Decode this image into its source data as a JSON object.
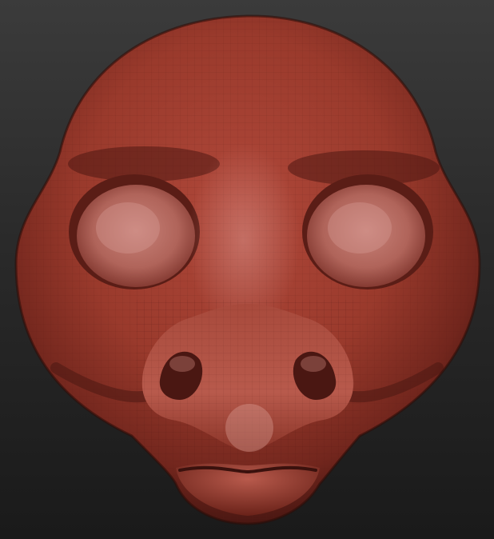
{
  "viewport": {
    "background_top": "#3b3b3b",
    "background_bottom": "#1a1a1a"
  },
  "model": {
    "subject": "sculpted-creature-head",
    "material_color": "#9a3a2c",
    "highlight_color": "#c67a70",
    "shadow_color": "#4a1712",
    "wireframe_visible": true
  }
}
